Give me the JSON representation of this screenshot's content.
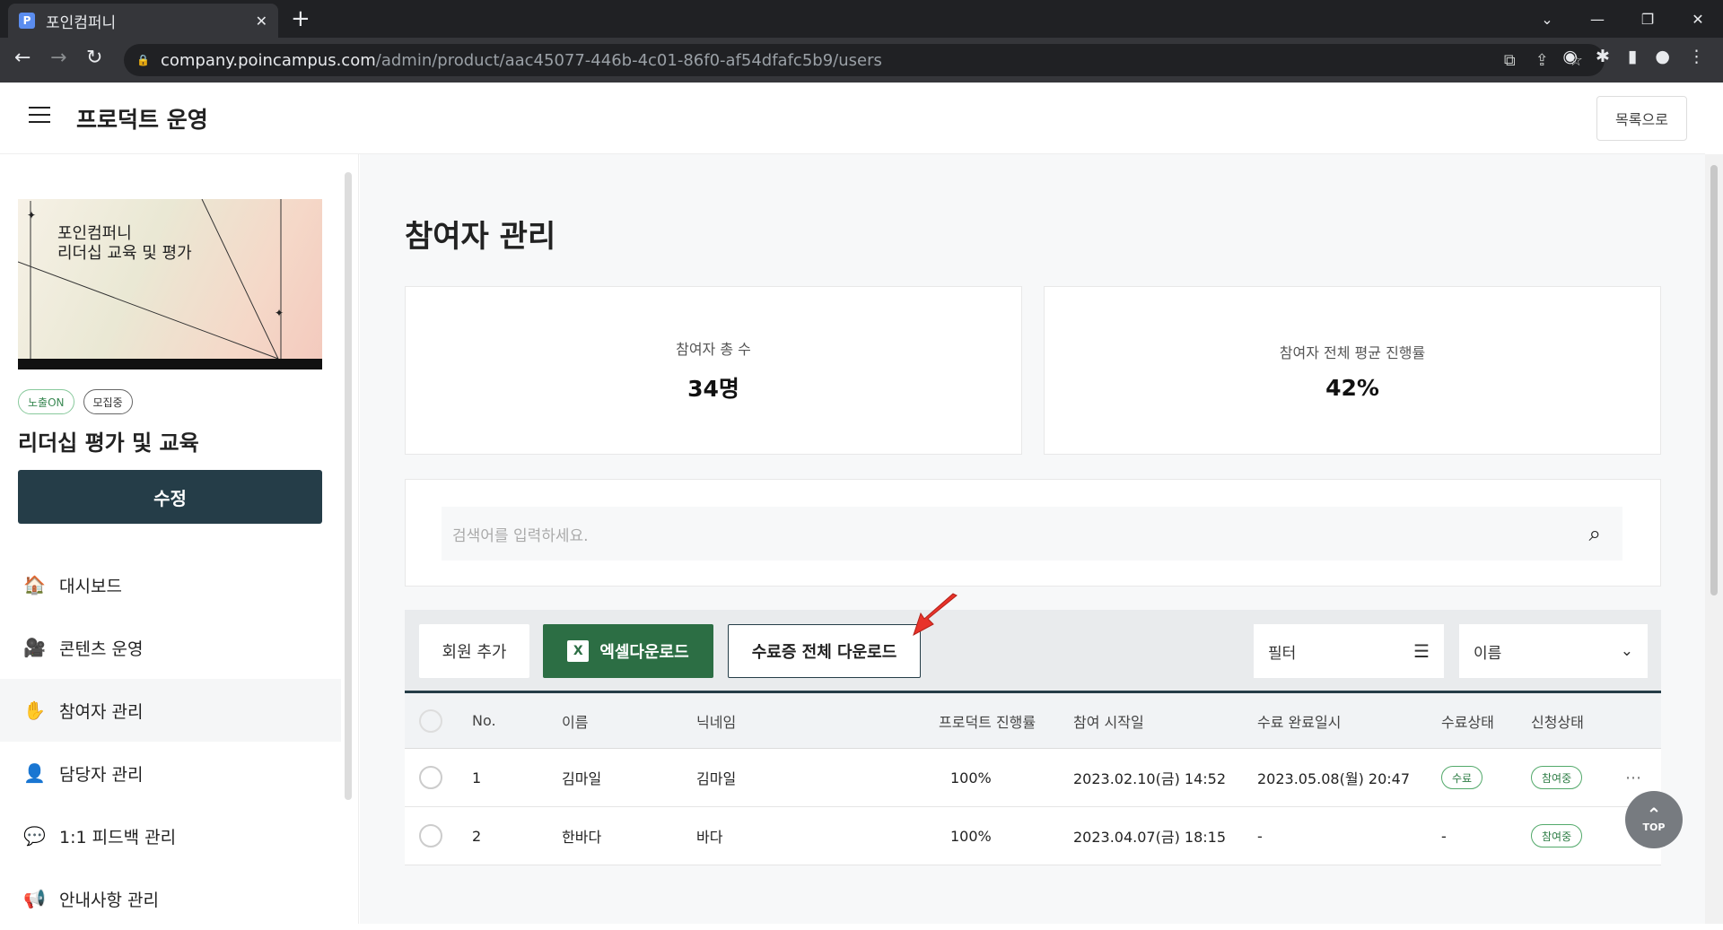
{
  "browser": {
    "tab_title": "포인컴퍼니",
    "favicon": "P",
    "url_host": "company.poincampus.com",
    "url_path": "/admin/product/aac45077-446b-4c01-86f0-af54dfafc5b9/users"
  },
  "header": {
    "title": "프로덕트 운영",
    "back_label": "목록으로"
  },
  "sidebar": {
    "thumb_line1": "포인컴퍼니",
    "thumb_line2": "리더십 교육 및 평가",
    "badges": [
      "노출ON",
      "모집중"
    ],
    "product_name": "리더십 평가 및 교육",
    "edit_label": "수정",
    "menu": [
      {
        "icon": "🏠",
        "label": "대시보드"
      },
      {
        "icon": "🎥",
        "label": "콘텐츠 운영"
      },
      {
        "icon": "✋",
        "label": "참여자 관리"
      },
      {
        "icon": "👤",
        "label": "담당자 관리"
      },
      {
        "icon": "💬",
        "label": "1:1 피드백 관리"
      },
      {
        "icon": "📢",
        "label": "안내사항 관리"
      }
    ]
  },
  "main": {
    "heading": "참여자 관리",
    "stats": [
      {
        "label": "참여자 총 수",
        "value": "34명"
      },
      {
        "label": "참여자 전체 평균 진행률",
        "value": "42%"
      }
    ],
    "search_placeholder": "검색어를 입력하세요.",
    "toolbar": {
      "add_label": "회원 추가",
      "excel_label": "엑셀다운로드",
      "cert_label": "수료증 전체 다운로드",
      "filter_label": "필터",
      "sort_label": "이름"
    },
    "columns": [
      "No.",
      "이름",
      "닉네임",
      "프로덕트 진행률",
      "참여 시작일",
      "수료 완료일시",
      "수료상태",
      "신청상태"
    ],
    "rows": [
      {
        "no": "1",
        "name": "김마일",
        "nick": "김마일",
        "progress": "100%",
        "start": "2023.02.10(금) 14:52",
        "complete": "2023.05.08(월) 20:47",
        "cert_status": "수료",
        "apply_status": "참여중"
      },
      {
        "no": "2",
        "name": "한바다",
        "nick": "바다",
        "progress": "100%",
        "start": "2023.04.07(금) 18:15",
        "complete": "-",
        "cert_status": "-",
        "apply_status": "참여중"
      }
    ],
    "top_label": "TOP"
  },
  "colors": {
    "accent": "#253d48",
    "excel": "#2c6e44",
    "arrow": "#e8332a"
  }
}
